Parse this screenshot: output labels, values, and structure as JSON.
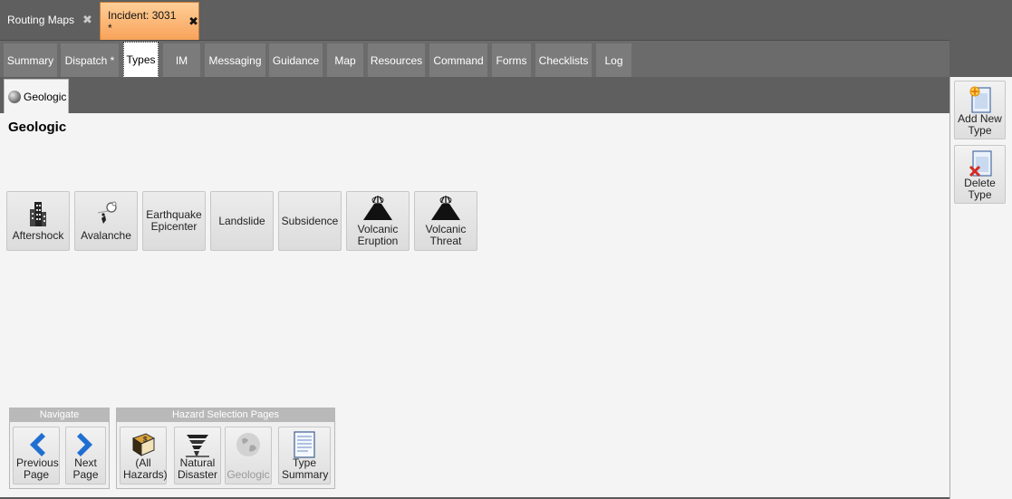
{
  "doc_tabs": [
    {
      "label": "Routing Maps",
      "close": "✖"
    },
    {
      "label": "Incident: 3031 *",
      "close": "✖"
    }
  ],
  "sub_tabs": [
    "Summary",
    "Dispatch *",
    "Types",
    "IM",
    "Messaging",
    "Guidance",
    "Map",
    "Resources",
    "Command",
    "Forms",
    "Checklists",
    "Log"
  ],
  "active_sub_tab": "Types",
  "category_tab": {
    "label": "Geologic",
    "icon": "globe-icon"
  },
  "page_title": "Geologic",
  "types": [
    {
      "label": "Aftershock",
      "icon": "building-icon"
    },
    {
      "label": "Avalanche",
      "icon": "avalanche-icon"
    },
    {
      "label": "Earthquake Epicenter",
      "icon": ""
    },
    {
      "label": "Landslide",
      "icon": ""
    },
    {
      "label": "Subsidence",
      "icon": ""
    },
    {
      "label": "Volcanic Eruption",
      "icon": "volcano-icon"
    },
    {
      "label": "Volcanic Threat",
      "icon": "volcano-icon"
    }
  ],
  "navigate": {
    "header": "Navigate",
    "previous": "Previous Page",
    "next": "Next Page"
  },
  "hazard_pages": {
    "header": "Hazard Selection Pages",
    "items": [
      {
        "label": "(All Hazards)",
        "icon": "book-icon",
        "enabled": true
      },
      {
        "label": "Natural Disaster",
        "icon": "tornado-icon",
        "enabled": true
      },
      {
        "label": "Geologic",
        "icon": "globe-icon",
        "enabled": false
      },
      {
        "label": "Type Summary",
        "icon": "document-icon",
        "enabled": true
      }
    ]
  },
  "sidebar": {
    "add_new_type": "Add New Type",
    "delete_type": "Delete Type"
  },
  "colors": {
    "active_tab_top": "#ffcf98",
    "active_tab_bottom": "#f8a25a",
    "nav_arrow": "#1f6fd1",
    "chrome": "#5f5f5f"
  }
}
